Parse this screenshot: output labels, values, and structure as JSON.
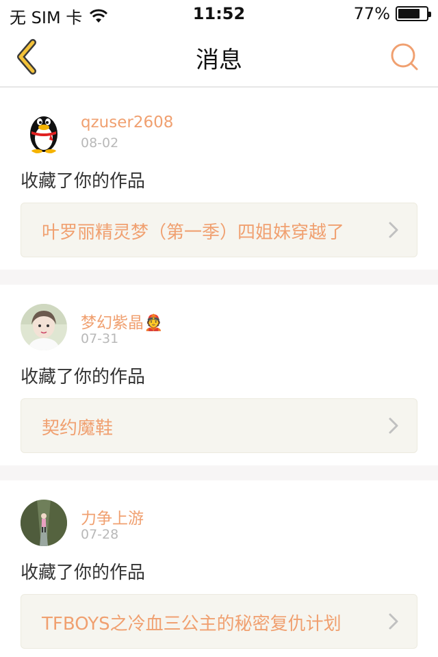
{
  "status_bar": {
    "carrier": "无 SIM 卡",
    "time": "11:52",
    "battery_percent": "77%",
    "battery_level": 0.77
  },
  "nav": {
    "title": "消息",
    "back_icon": "chevron-left-icon",
    "search_icon": "search-icon"
  },
  "colors": {
    "accent": "#f0a070",
    "nav_icon": "#f3c23a",
    "box_bg": "#f6f5ef"
  },
  "messages": [
    {
      "username": "qzuser2608",
      "date": "08-02",
      "action": "收藏了你的作品",
      "work_title": "叶罗丽精灵梦（第一季）四姐妹穿越了",
      "avatar": "penguin-avatar"
    },
    {
      "username": "梦幻紫晶👲",
      "date": "07-31",
      "action": "收藏了你的作品",
      "work_title": "契约魔鞋",
      "avatar": "girl-photo-avatar"
    },
    {
      "username": "力争上游",
      "date": "07-28",
      "action": "收藏了你的作品",
      "work_title": "TFBOYS之冷血三公主的秘密复仇计划",
      "avatar": "alley-photo-avatar"
    }
  ]
}
